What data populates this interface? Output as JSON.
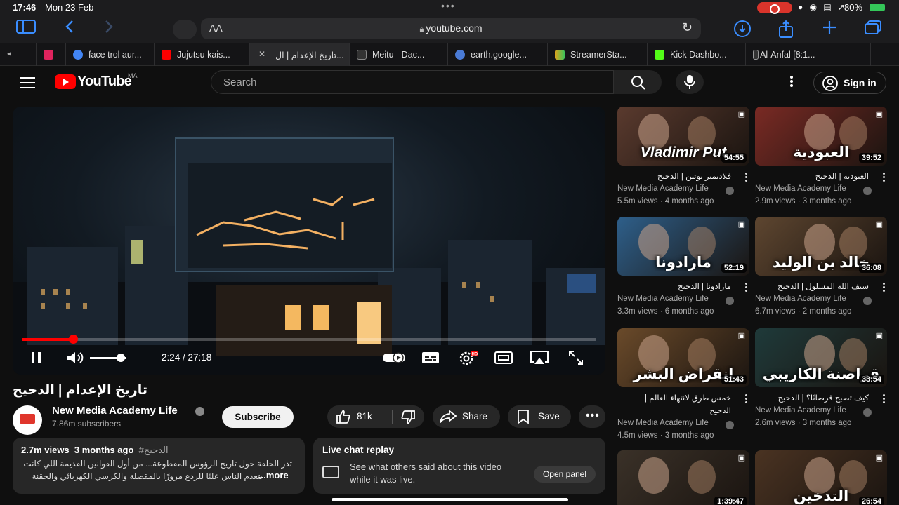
{
  "status_bar": {
    "time": "17:46",
    "date": "Mon 23 Feb",
    "battery": "80%"
  },
  "browser": {
    "address_text_size": "AA",
    "url": "youtube.com",
    "tabs": [
      {
        "label": "face trol aur...",
        "color": "#4285f4"
      },
      {
        "label": "Jujutsu kais...",
        "color": "#ff0000"
      },
      {
        "label": "تاريخ الإعدام | ال...",
        "color": "#ff0000",
        "active": true
      },
      {
        "label": "Meitu - Dac...",
        "color": "#888888"
      },
      {
        "label": "earth.google...",
        "color": "#4a7bd6"
      },
      {
        "label": "StreamerSta...",
        "color": "#e0a31c"
      },
      {
        "label": "Kick Dashbo...",
        "color": "#53fc18"
      },
      {
        "label": "Al-Anfal [8:1...",
        "color": "#999999"
      }
    ]
  },
  "masthead": {
    "logo_text": "YouTube",
    "country_code": "MA",
    "search_placeholder": "Search",
    "signin_label": "Sign in"
  },
  "player": {
    "time_display": "2:24 / 27:18",
    "progress_fraction": 0.088,
    "volume_fraction": 0.85
  },
  "video": {
    "title": "تاريخ الإعدام | الدحيح",
    "channel_name": "New Media Academy Life",
    "subscribers": "7.86m subscribers",
    "subscribe_label": "Subscribe",
    "likes": "81k",
    "share_label": "Share",
    "save_label": "Save"
  },
  "description": {
    "views": "2.7m views",
    "age": "3 months ago",
    "hashtag": "#الدحيح",
    "line1": "تدر الحلقة حول تاريخ الرؤوس المقطوعة... من أول القوانين القديمة اللي كانت",
    "line2": "بتعدم الناس علنًا للردع مرورًا بالمقصلة والكرسي الكهربائي والحقنة",
    "more_label": "...more"
  },
  "live_chat": {
    "title": "Live chat replay",
    "line1": "See what others said about this video",
    "line2": "while it was live.",
    "open_label": "Open panel"
  },
  "recommendations": [
    {
      "overlay": "Vladimir Put",
      "duration": "54:55",
      "title": "فلاديمير بوتين | الدحيح",
      "channel": "New Media Academy Life",
      "meta": "5.5m views · 4 months ago",
      "bg": "#5a3a2e"
    },
    {
      "overlay": "العبودية",
      "duration": "39:52",
      "title": "العبودية | الدحيح",
      "channel": "New Media Academy Life",
      "meta": "2.9m views · 3 months ago",
      "bg": "#7a2a24"
    },
    {
      "overlay": "مارادونا",
      "duration": "52:19",
      "title": "مارادونا | الدحيح",
      "channel": "New Media Academy Life",
      "meta": "3.3m views · 6 months ago",
      "bg": "#2e5f8a"
    },
    {
      "overlay": "خالد بن الوليد",
      "duration": "36:08",
      "title": "سيف الله المسلول | الدحيح",
      "channel": "New Media Academy Life",
      "meta": "6.7m views · 2 months ago",
      "bg": "#5e4630"
    },
    {
      "overlay": "انقراض البشر",
      "duration": "51:43",
      "title": "خمس طرق لانتهاء العالم |",
      "title2": "الدحيح",
      "channel": "New Media Academy Life",
      "meta": "4.5m views · 3 months ago",
      "bg": "#6a4a2a"
    },
    {
      "overlay": "قراصنة الكاريبي",
      "duration": "33:54",
      "title": "كيف تصبح قرصانًا؟ | الدحيح",
      "channel": "New Media Academy Life",
      "meta": "2.6m views · 3 months ago",
      "bg": "#1f3a3a"
    },
    {
      "overlay": "",
      "duration": "1:39:47",
      "title": "",
      "channel": "",
      "meta": "",
      "bg": "#3a3128"
    },
    {
      "overlay": "التدخين",
      "duration": "26:54",
      "title": "",
      "channel": "",
      "meta": "",
      "bg": "#4a3322"
    }
  ],
  "colors": {
    "accent_red": "#ff0000",
    "background": "#0f0f0f",
    "surface": "#272727",
    "link_blue": "#3a8dff"
  }
}
